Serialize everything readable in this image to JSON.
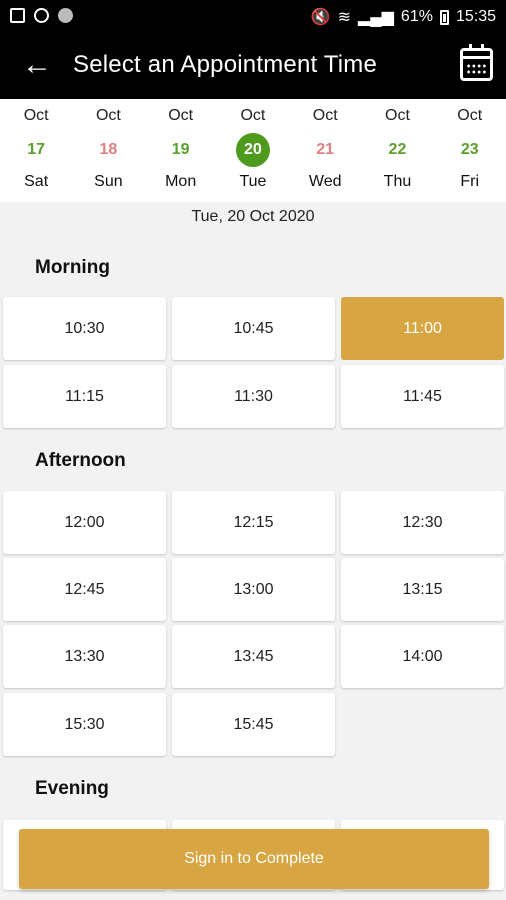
{
  "status_bar": {
    "battery": "61%",
    "time": "15:35"
  },
  "header": {
    "title": "Select an Appointment Time"
  },
  "dates": [
    {
      "month": "Oct",
      "day": "17",
      "weekday": "Sat",
      "state": "available"
    },
    {
      "month": "Oct",
      "day": "18",
      "weekday": "Sun",
      "state": "unavailable"
    },
    {
      "month": "Oct",
      "day": "19",
      "weekday": "Mon",
      "state": "available"
    },
    {
      "month": "Oct",
      "day": "20",
      "weekday": "Tue",
      "state": "selected"
    },
    {
      "month": "Oct",
      "day": "21",
      "weekday": "Wed",
      "state": "unavailable"
    },
    {
      "month": "Oct",
      "day": "22",
      "weekday": "Thu",
      "state": "available"
    },
    {
      "month": "Oct",
      "day": "23",
      "weekday": "Fri",
      "state": "available"
    }
  ],
  "selected_date": "Tue, 20 Oct 2020",
  "sections": {
    "morning": {
      "label": "Morning",
      "slots": [
        "10:30",
        "10:45",
        "11:00",
        "11:15",
        "11:30",
        "11:45"
      ],
      "selected": "11:00"
    },
    "afternoon": {
      "label": "Afternoon",
      "slots": [
        "12:00",
        "12:15",
        "12:30",
        "12:45",
        "13:00",
        "13:15",
        "13:30",
        "13:45",
        "14:00",
        "15:30",
        "15:45"
      ]
    },
    "evening": {
      "label": "Evening"
    }
  },
  "cta_label": "Sign in to Complete",
  "colors": {
    "available": "#5aa02c",
    "unavailable": "#e08080",
    "selected_date_bg": "#4e9a1c",
    "accent": "#d7a642"
  }
}
